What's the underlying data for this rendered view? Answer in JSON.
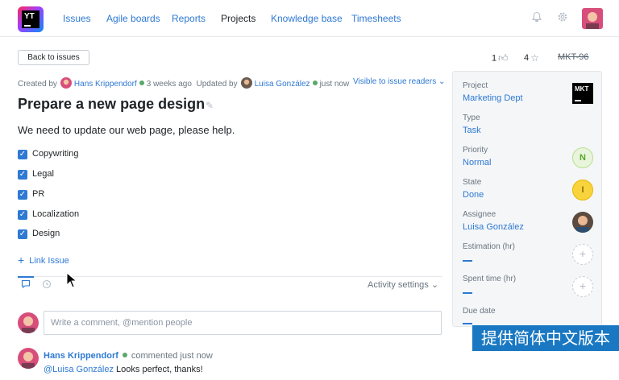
{
  "logo": {
    "text": "YT"
  },
  "nav": [
    {
      "label": "Issues",
      "active": false
    },
    {
      "label": "Agile boards",
      "active": false
    },
    {
      "label": "Reports",
      "active": false
    },
    {
      "label": "Projects",
      "active": true
    },
    {
      "label": "Knowledge base",
      "active": false
    },
    {
      "label": "Timesheets",
      "active": false
    }
  ],
  "header_icons": [
    "bell-icon",
    "gear-icon"
  ],
  "toolbar": {
    "back_label": "Back to issues",
    "votes": "1",
    "stars": "4",
    "issue_id": "MKT-96"
  },
  "meta": {
    "created_by_label": "Created by",
    "creator": "Hans Krippendorf",
    "created_ago": "3 weeks ago",
    "updated_by_label": "Updated by",
    "updater": "Luisa González",
    "updated_ago": "just now",
    "visibility": "Visible to issue readers"
  },
  "issue": {
    "title": "Prepare a new page design",
    "description": "We need to update our web page, please help.",
    "checklist": [
      "Copywriting",
      "Legal",
      "PR",
      "Localization",
      "Design"
    ],
    "link_issue_label": "Link Issue"
  },
  "activity": {
    "settings_label": "Activity settings",
    "comment_placeholder": "Write a comment, @mention people"
  },
  "comment": {
    "author": "Hans Krippendorf",
    "action": "commented just now",
    "mention": "@Luisa González",
    "text": " Looks perfect, thanks!"
  },
  "fields": {
    "project_label": "Project",
    "project_value": "Marketing Dept",
    "project_logo_text": "MKT",
    "type_label": "Type",
    "type_value": "Task",
    "priority_label": "Priority",
    "priority_value": "Normal",
    "priority_badge": "N",
    "state_label": "State",
    "state_value": "Done",
    "state_badge": "I",
    "assignee_label": "Assignee",
    "assignee_value": "Luisa González",
    "estimation_label": "Estimation (hr)",
    "spent_label": "Spent time (hr)",
    "due_label": "Due date"
  },
  "banner": {
    "text": "提供简体中文版本"
  },
  "colors": {
    "accent": "#2e79d3",
    "online": "#59a869",
    "done": "#f9d33c"
  }
}
